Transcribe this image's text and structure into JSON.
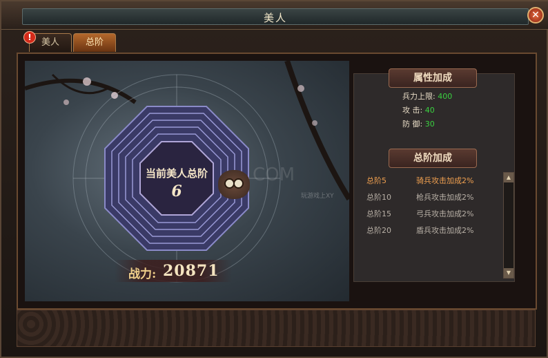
{
  "window": {
    "title": "美人"
  },
  "tabs": [
    {
      "label": "美人",
      "active": false,
      "alert": "!"
    },
    {
      "label": "总阶",
      "active": true
    }
  ],
  "scene": {
    "rank_label": "当前美人总阶",
    "rank_value": "6",
    "power_label": "战力:",
    "power_value": "20871",
    "watermark": "COM",
    "watermark_sub": "玩游戏上XY"
  },
  "attributes": {
    "header": "属性加成",
    "rows": [
      {
        "label": "兵力上限:",
        "value": "400"
      },
      {
        "label": "攻      击:",
        "value": "40"
      },
      {
        "label": "防      御:",
        "value": "30"
      }
    ],
    "value_color": "#3ad140"
  },
  "rank_bonus": {
    "header": "总阶加成",
    "rows": [
      {
        "level": "总阶5",
        "desc": "骑兵攻击加成2%",
        "active": true
      },
      {
        "level": "总阶10",
        "desc": "枪兵攻击加成2%",
        "active": false
      },
      {
        "level": "总阶15",
        "desc": "弓兵攻击加成2%",
        "active": false
      },
      {
        "level": "总阶20",
        "desc": "盾兵攻击加成2%",
        "active": false
      }
    ],
    "active_color": "#f0a050"
  },
  "icons": {
    "close": "close-icon",
    "alert": "alert-icon",
    "owl": "owl-icon",
    "scroll_up": "arrow-up-icon",
    "scroll_down": "arrow-down-icon"
  }
}
